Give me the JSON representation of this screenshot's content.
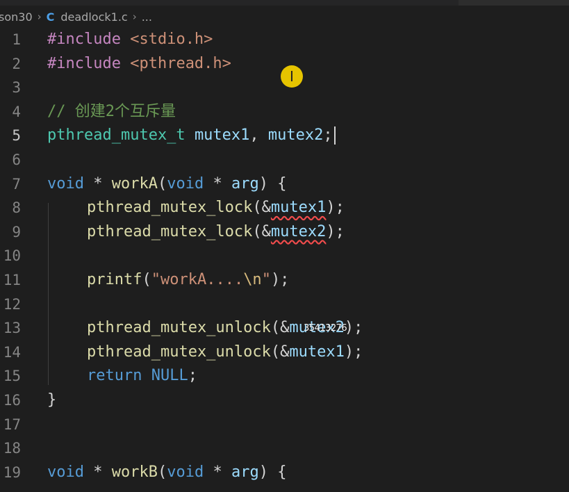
{
  "breadcrumb": {
    "folder": "son30",
    "file_icon": "C",
    "file": "deadlock1.c",
    "more": "..."
  },
  "lines": [
    {
      "num": "1",
      "parts": [
        [
          "pre",
          "#include "
        ],
        [
          "inc",
          "<stdio.h>"
        ]
      ]
    },
    {
      "num": "2",
      "parts": [
        [
          "pre",
          "#include "
        ],
        [
          "inc",
          "<pthread.h>"
        ]
      ]
    },
    {
      "num": "3",
      "parts": []
    },
    {
      "num": "4",
      "parts": [
        [
          "comment",
          "// 创建2个互斥量"
        ]
      ]
    },
    {
      "num": "5",
      "active": true,
      "caret": true,
      "parts": [
        [
          "type",
          "pthread_mutex_t"
        ],
        [
          "plain",
          " "
        ],
        [
          "var",
          "mutex1"
        ],
        [
          "plain",
          ", "
        ],
        [
          "var",
          "mutex2"
        ],
        [
          "plain",
          ";"
        ]
      ]
    },
    {
      "num": "6",
      "parts": []
    },
    {
      "num": "7",
      "parts": [
        [
          "kw",
          "void"
        ],
        [
          "plain",
          " * "
        ],
        [
          "fn",
          "workA"
        ],
        [
          "plain",
          "("
        ],
        [
          "kw",
          "void"
        ],
        [
          "plain",
          " * "
        ],
        [
          "var",
          "arg"
        ],
        [
          "plain",
          ") {"
        ]
      ]
    },
    {
      "num": "8",
      "indent": 1,
      "parts": [
        [
          "fn",
          "pthread_mutex_lock"
        ],
        [
          "plain",
          "(&"
        ],
        [
          "var-sq",
          "mutex1"
        ],
        [
          "plain",
          ");"
        ]
      ]
    },
    {
      "num": "9",
      "indent": 1,
      "parts": [
        [
          "fn",
          "pthread_mutex_lock"
        ],
        [
          "plain",
          "(&"
        ],
        [
          "var-sq",
          "mutex2"
        ],
        [
          "plain",
          ");"
        ]
      ]
    },
    {
      "num": "10",
      "parts": []
    },
    {
      "num": "11",
      "indent": 1,
      "parts": [
        [
          "fn",
          "printf"
        ],
        [
          "plain",
          "("
        ],
        [
          "str",
          "\"workA...."
        ],
        [
          "esc",
          "\\n"
        ],
        [
          "str",
          "\""
        ],
        [
          "plain",
          ");"
        ]
      ]
    },
    {
      "num": "12",
      "parts": []
    },
    {
      "num": "13",
      "indent": 1,
      "parts": [
        [
          "fn",
          "pthread_mutex_unlock"
        ],
        [
          "plain",
          "(&"
        ],
        [
          "var",
          "mutex2"
        ],
        [
          "plain",
          ");"
        ]
      ]
    },
    {
      "num": "14",
      "indent": 1,
      "parts": [
        [
          "fn",
          "pthread_mutex_unlock"
        ],
        [
          "plain",
          "(&"
        ],
        [
          "var",
          "mutex1"
        ],
        [
          "plain",
          ");"
        ]
      ]
    },
    {
      "num": "15",
      "indent": 1,
      "parts": [
        [
          "kw",
          "return"
        ],
        [
          "plain",
          " "
        ],
        [
          "kw",
          "NULL"
        ],
        [
          "plain",
          ";"
        ]
      ]
    },
    {
      "num": "16",
      "parts": [
        [
          "plain",
          "}"
        ]
      ]
    },
    {
      "num": "17",
      "parts": []
    },
    {
      "num": "18",
      "parts": []
    },
    {
      "num": "19",
      "parts": [
        [
          "kw",
          "void"
        ],
        [
          "plain",
          " * "
        ],
        [
          "fn",
          "workB"
        ],
        [
          "plain",
          "("
        ],
        [
          "kw",
          "void"
        ],
        [
          "plain",
          " * "
        ],
        [
          "var",
          "arg"
        ],
        [
          "plain",
          ") {"
        ]
      ]
    }
  ],
  "overlay": {
    "cursor_glyph": "I",
    "watermark": "35413276"
  },
  "colors": {
    "background": "#1e1e1e",
    "preprocessor": "#c586c0",
    "include": "#ce9178",
    "comment": "#6a9955",
    "type": "#4ec9b0",
    "keyword": "#569cd6",
    "variable": "#9cdcfe",
    "function": "#dcdcaa",
    "string": "#ce9178",
    "error_squiggle": "#f14c4c",
    "cursor_highlight": "#e6c400"
  }
}
